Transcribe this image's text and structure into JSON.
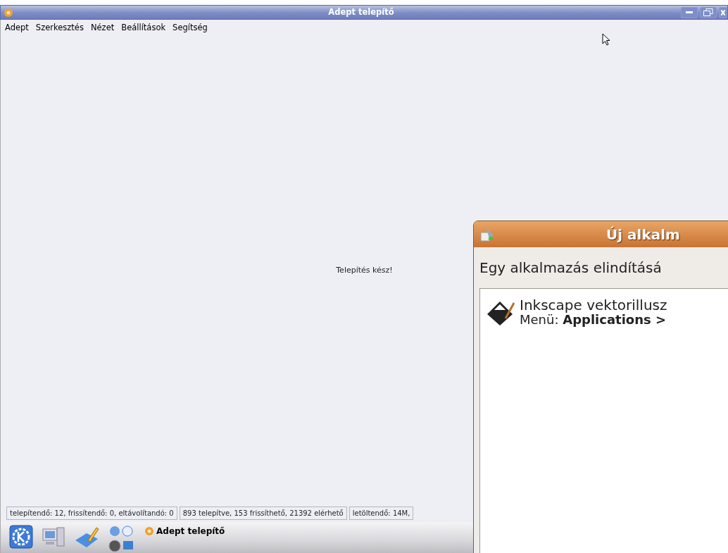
{
  "window": {
    "title": "Adept telepítő"
  },
  "menu": [
    "Adept",
    "Szerkesztés",
    "Nézet",
    "Beállítások",
    "Segítség"
  ],
  "content": {
    "message": "Telepítés kész!"
  },
  "status_bar": [
    "telepítendő: 12, frissítendő: 0, eltávolítandó: 0",
    "893 telepítve, 153 frissíthető, 21392 elérhető",
    "letöltendő: 14M,"
  ],
  "taskbar": {
    "tasks": [
      {
        "label": "Adept telepítő",
        "selected": false
      }
    ]
  },
  "dialog": {
    "title": "Új alkalm",
    "message": "Egy alkalmazás elindításá",
    "items": [
      {
        "name": "Inkscape vektorillusz",
        "menu": "Menü: **Applications >**"
      }
    ]
  }
}
